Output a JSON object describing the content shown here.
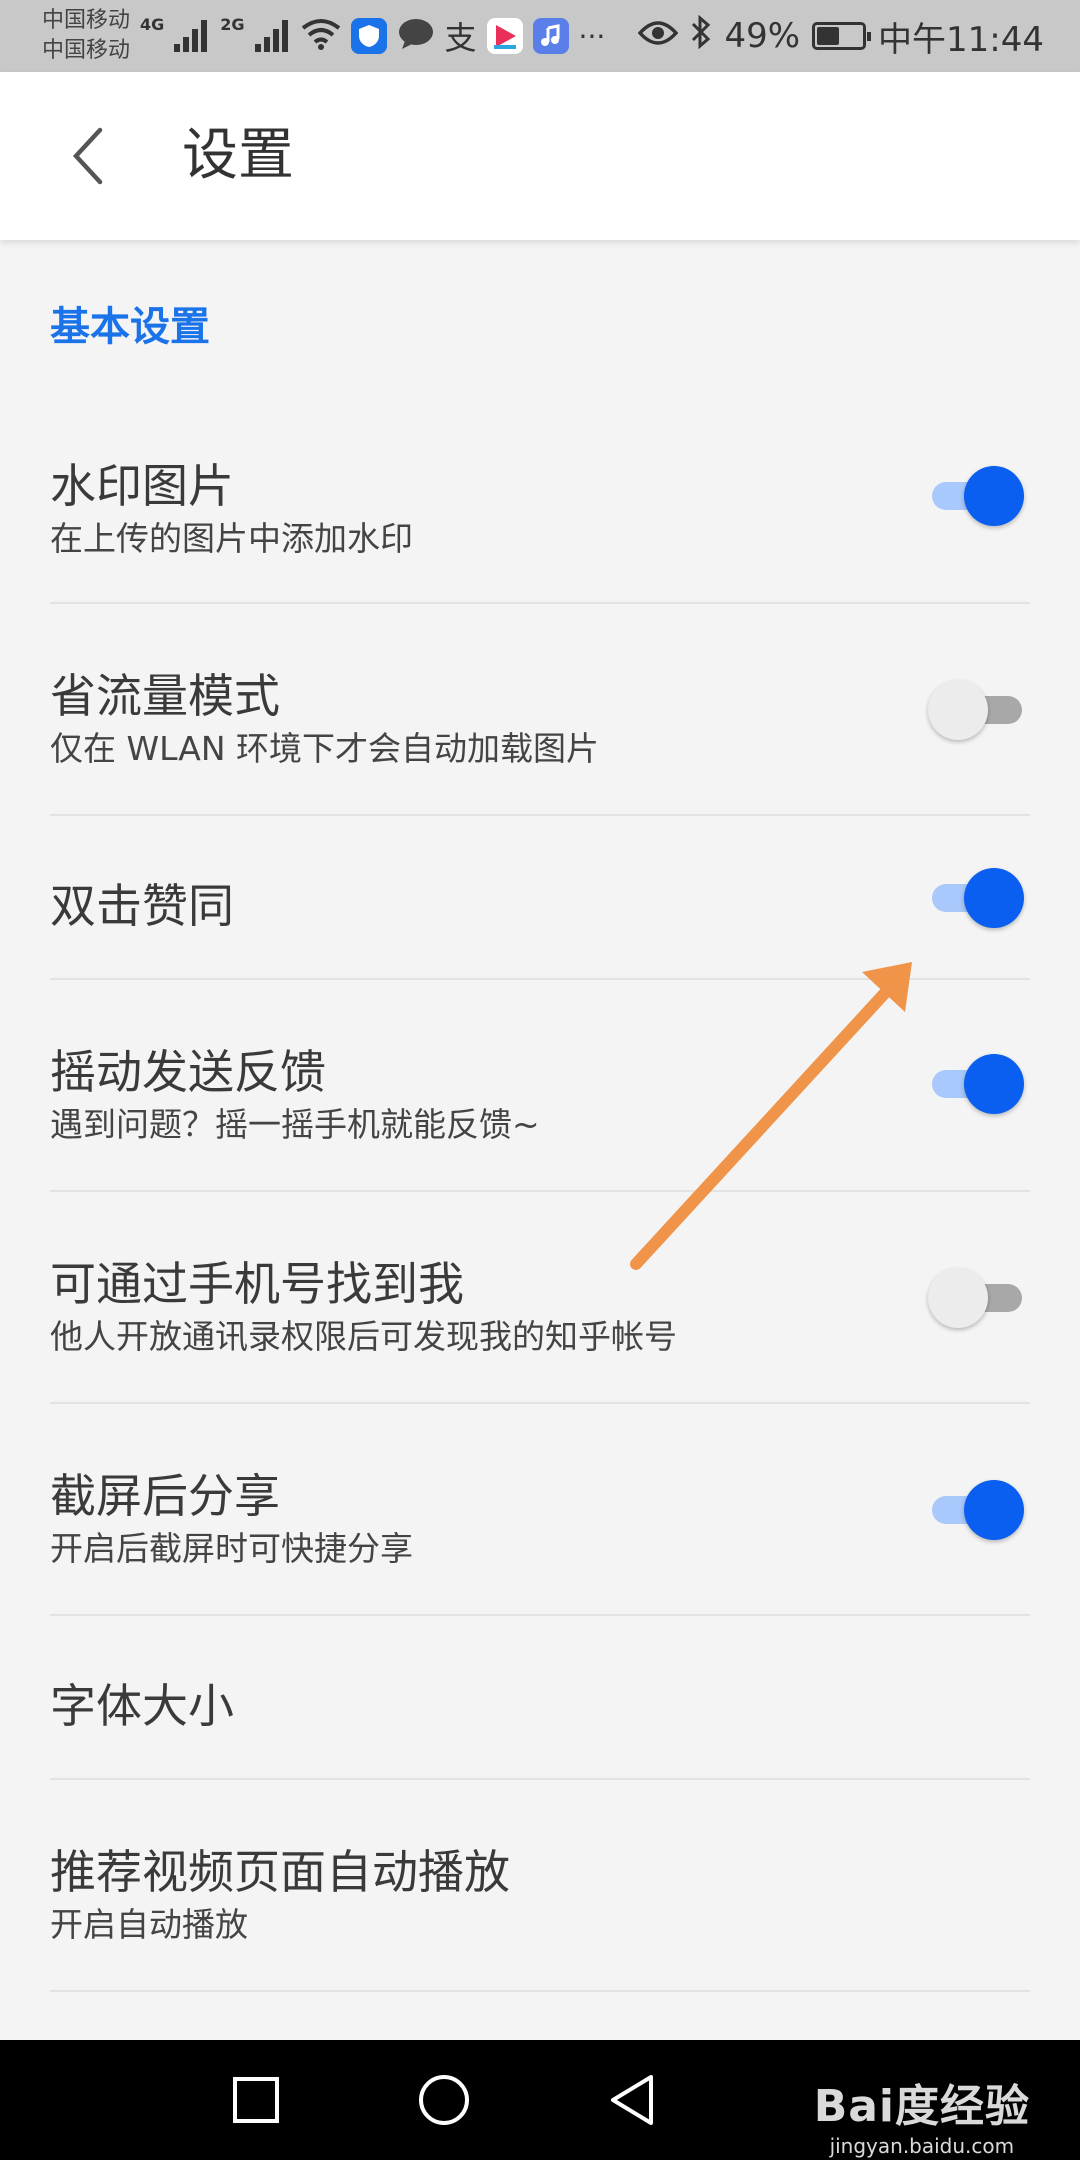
{
  "status_bar": {
    "carrier_1": "中国移动",
    "carrier_2": "中国移动",
    "net_1": "4G",
    "net_2": "2G",
    "battery_text": "49%",
    "battery_level": 0.49,
    "time": "中午11:44",
    "more": "···",
    "app_icons": [
      "shield-app-icon",
      "chat-bubble-icon",
      "alipay-icon",
      "video-app-icon",
      "music-app-icon"
    ]
  },
  "app_bar": {
    "title": "设置",
    "back_icon": "chevron-left-icon"
  },
  "section": {
    "title": "基本设置",
    "accent_color": "#1a73e8"
  },
  "settings": [
    {
      "title": "水印图片",
      "subtitle": "在上传的图片中添加水印",
      "toggle": true
    },
    {
      "title": "省流量模式",
      "subtitle": "仅在 WLAN 环境下才会自动加载图片",
      "toggle": false
    },
    {
      "title": "双击赞同",
      "subtitle": "",
      "toggle": true
    },
    {
      "title": "摇动发送反馈",
      "subtitle": "遇到问题？摇一摇手机就能反馈~",
      "toggle": true
    },
    {
      "title": "可通过手机号找到我",
      "subtitle": "他人开放通讯录权限后可发现我的知乎帐号",
      "toggle": false
    },
    {
      "title": "截屏后分享",
      "subtitle": "开启后截屏时可快捷分享",
      "toggle": true
    },
    {
      "title": "字体大小",
      "subtitle": ""
    },
    {
      "title": "推荐视频页面自动播放",
      "subtitle": "开启自动播放"
    }
  ],
  "colors": {
    "toggle_on_knob": "#0a5ff0",
    "toggle_on_track": "#a9c8fb",
    "toggle_off_knob": "#ececec",
    "toggle_off_track": "#a8a8a8",
    "arrow": "#f0944a"
  },
  "nav_bar": {
    "buttons": [
      "recent-apps-icon",
      "home-icon",
      "back-triangle-icon"
    ],
    "watermark_main": "Bai度经验",
    "watermark_url": "jingyan.baidu.com"
  }
}
